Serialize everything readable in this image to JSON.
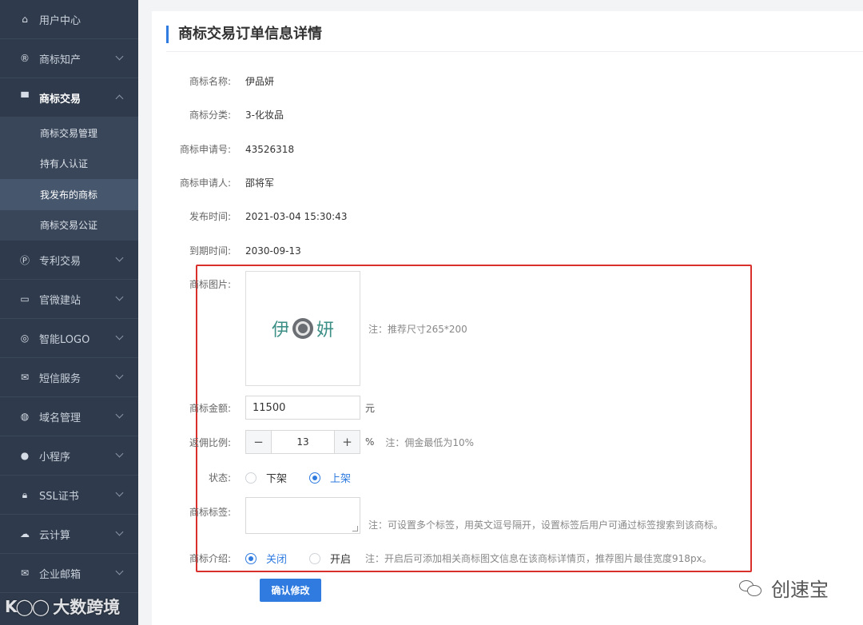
{
  "sidebar": {
    "items": [
      {
        "label": "用户中心",
        "icon": "home-icon"
      },
      {
        "label": "商标知产",
        "icon": "registered-icon"
      },
      {
        "label": "商标交易",
        "icon": "cart-icon"
      },
      {
        "label": "专利交易",
        "icon": "patent-icon"
      },
      {
        "label": "官微建站",
        "icon": "monitor-icon"
      },
      {
        "label": "智能LOGO",
        "icon": "logo-icon"
      },
      {
        "label": "短信服务",
        "icon": "sms-icon"
      },
      {
        "label": "域名管理",
        "icon": "globe-icon"
      },
      {
        "label": "小程序",
        "icon": "miniprogram-icon"
      },
      {
        "label": "SSL证书",
        "icon": "lock-icon"
      },
      {
        "label": "云计算",
        "icon": "cloud-icon"
      },
      {
        "label": "企业邮箱",
        "icon": "mail-icon"
      }
    ],
    "subitems": [
      "商标交易管理",
      "持有人认证",
      "我发布的商标",
      "商标交易公证"
    ]
  },
  "page": {
    "title": "商标交易订单信息详情"
  },
  "fields": {
    "name": {
      "label": "商标名称:",
      "value": "伊品妍"
    },
    "category": {
      "label": "商标分类:",
      "value": "3-化妆品"
    },
    "app_no": {
      "label": "商标申请号:",
      "value": "43526318"
    },
    "applicant": {
      "label": "商标申请人:",
      "value": "邵将军"
    },
    "publish_time": {
      "label": "发布时间:",
      "value": "2021-03-04 15:30:43"
    },
    "expire_time": {
      "label": "到期时间:",
      "value": "2030-09-13"
    }
  },
  "form": {
    "image": {
      "label": "商标图片:",
      "logo_left": "伊",
      "logo_right": "妍",
      "note": "注：推荐尺寸265*200"
    },
    "price": {
      "label": "商标金额:",
      "value": "11500",
      "unit": "元"
    },
    "commission": {
      "label": "返佣比例:",
      "value": "13",
      "minus": "−",
      "plus": "+",
      "unit": "%",
      "note": "注：佣金最低为10%"
    },
    "status": {
      "label": "状态:",
      "options": [
        "下架",
        "上架"
      ],
      "selected": "上架"
    },
    "tags": {
      "label": "商标标签:",
      "value": "",
      "note": "注：可设置多个标签，用英文逗号隔开，设置标签后用户可通过标签搜索到该商标。"
    },
    "intro": {
      "label": "商标介绍:",
      "options": [
        "关闭",
        "开启"
      ],
      "selected": "关闭",
      "note": "注：开启后可添加相关商标图文信息在该商标详情页，推荐图片最佳宽度918px。"
    },
    "submit_label": "确认修改"
  },
  "watermarks": {
    "left_text": "大数跨境",
    "right_text": "创速宝"
  },
  "colors": {
    "sidebar_bg": "#2f3b4c",
    "accent": "#2f7be0",
    "highlight": "#d9302c"
  }
}
